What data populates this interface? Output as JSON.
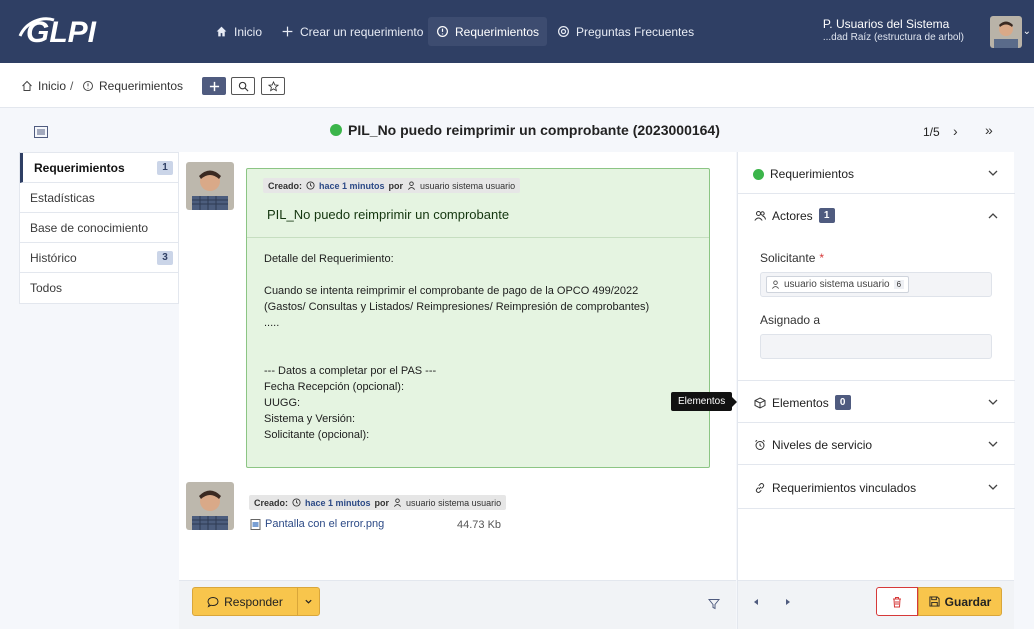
{
  "nav": {
    "logo": "GLPI",
    "items": [
      {
        "label": "Inicio",
        "icon": "home-icon"
      },
      {
        "label": "Crear un requerimiento",
        "icon": "plus-icon"
      },
      {
        "label": "Requerimientos",
        "icon": "ticket-status-icon"
      },
      {
        "label": "Preguntas Frecuentes",
        "icon": "help-icon"
      }
    ],
    "active_index": 2,
    "user_name": "P. Usuarios del Sistema",
    "user_entity": "...dad Raíz (estructura de arbol)"
  },
  "breadcrumb": {
    "home": "Inicio",
    "sep": "/",
    "current": "Requerimientos"
  },
  "ticket": {
    "title": "PIL_No puedo reimprimir un comprobante (2023000164)",
    "status_color": "#3bb54a",
    "pager": "1/5"
  },
  "left_tabs": [
    {
      "label": "Requerimientos",
      "badge": "1"
    },
    {
      "label": "Estadísticas",
      "badge": ""
    },
    {
      "label": "Base de conocimiento",
      "badge": ""
    },
    {
      "label": "Histórico",
      "badge": "3"
    },
    {
      "label": "Todos",
      "badge": ""
    }
  ],
  "timeline": {
    "item1": {
      "created_label": "Creado:",
      "created_time": "hace 1 minutos",
      "by_label": "por",
      "author": "usuario sistema usuario",
      "title": "PIL_No puedo reimprimir un comprobante",
      "body": "Detalle del Requerimiento:\n\nCuando se intenta reimprimir el comprobante de pago de la OPCO 499/2022\n(Gastos/ Consultas y Listados/ Reimpresiones/ Reimpresión de comprobantes)\n .....\n\n\n--- Datos a completar por el PAS ---\nFecha Recepción (opcional):\nUUGG:\nSistema y Versión:\nSolicitante (opcional):"
    },
    "item2": {
      "created_label": "Creado:",
      "created_time": "hace 1 minutos",
      "by_label": "por",
      "author": "usuario sistema usuario",
      "file_name": "Pantalla con el error.png",
      "file_size": "44.73 Kb"
    }
  },
  "tooltip": "Elementos",
  "right": {
    "status_label": "Requerimientos",
    "actors_label": "Actores",
    "actors_count": "1",
    "requester_label": "Solicitante",
    "required_mark": "*",
    "requester_name": "usuario sistema usuario",
    "requester_count": "6",
    "assigned_label": "Asignado a",
    "items_label": "Elementos",
    "items_count": "0",
    "sla_label": "Niveles de servicio",
    "linked_label": "Requerimientos vinculados"
  },
  "footer": {
    "reply_label": "Responder",
    "save_label": "Guardar"
  },
  "colors": {
    "navbar": "#2f3f64",
    "accent_yellow": "#f8c54c",
    "bubble_green": "#e5f4e1",
    "danger": "#d63939"
  }
}
